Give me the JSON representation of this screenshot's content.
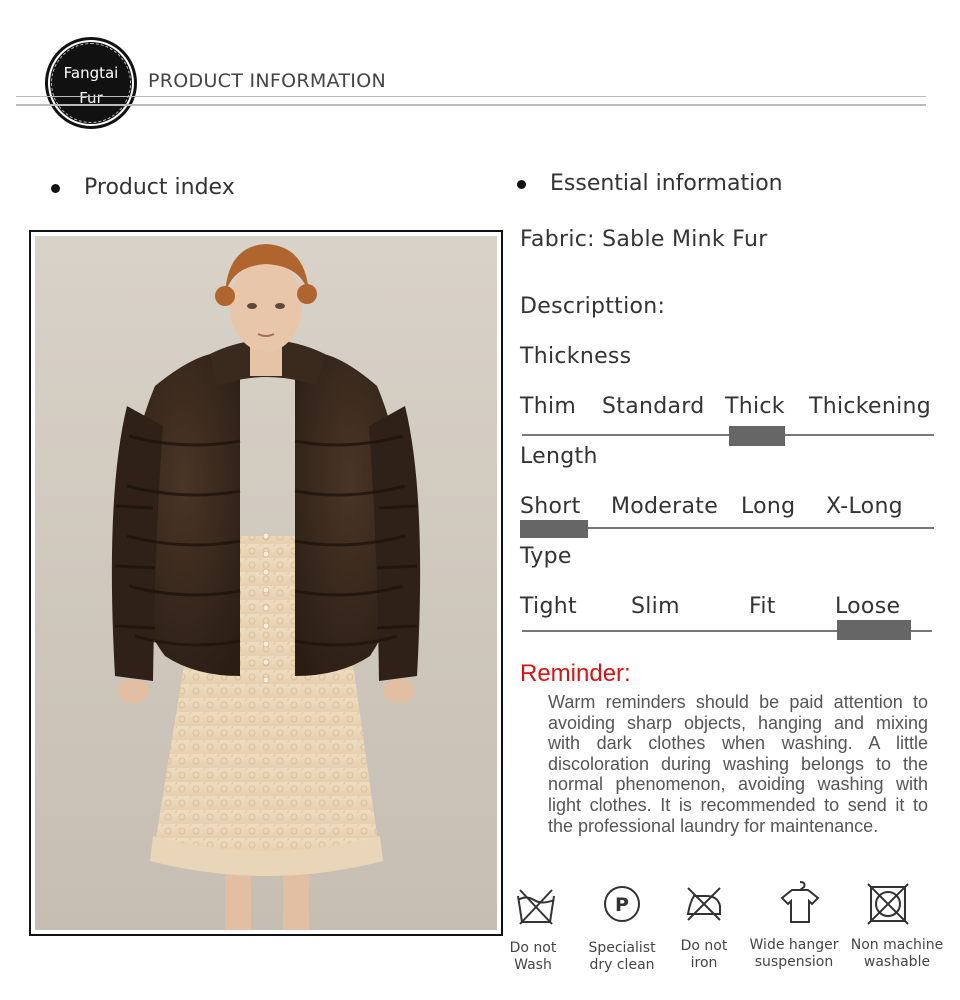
{
  "header": {
    "logo_line1": "Fangtai",
    "logo_line2": "Fur",
    "title": "PRODUCT INFORMATION"
  },
  "left": {
    "section_title": "Product index"
  },
  "right": {
    "section_title": "Essential information",
    "fabric": "Fabric: Sable Mink  Fur",
    "description": "Descripttion:",
    "thickness": {
      "label": "Thickness",
      "options": [
        "Thim",
        "Standard",
        "Thick",
        "Thickening"
      ],
      "selected": "Thick"
    },
    "length": {
      "label": "Length",
      "options": [
        "Short",
        "Moderate",
        "Long",
        "X-Long"
      ],
      "selected": "Short"
    },
    "type": {
      "label": "Type",
      "options": [
        "Tight",
        "Slim",
        "Fit",
        "Loose"
      ],
      "selected": "Loose"
    }
  },
  "reminder": {
    "title": "Reminder:",
    "body": "Warm reminders should be paid attention to avoiding sharp objects, hanging and mixing with dark clothes when washing. A little discoloration during washing belongs to the normal phenomenon, avoiding washing with light clothes. It is recommended to send it to the professional laundry for maintenance."
  },
  "care": [
    {
      "icon": "do-not-wash-icon",
      "line1": "Do not",
      "line2": "Wash"
    },
    {
      "icon": "dry-clean-p-icon",
      "line1": "Specialist",
      "line2": "dry clean"
    },
    {
      "icon": "do-not-iron-icon",
      "line1": "Do not",
      "line2": "iron"
    },
    {
      "icon": "hanger-icon",
      "line1": "Wide hanger",
      "line2": "suspension"
    },
    {
      "icon": "no-machine-wash-icon",
      "line1": "Non machine",
      "line2": "washable"
    }
  ],
  "colors": {
    "reminder_red": "#e01010",
    "rule_gray": "#777777",
    "marker_gray": "#666666",
    "coat_brown": "#3b2a1e"
  }
}
